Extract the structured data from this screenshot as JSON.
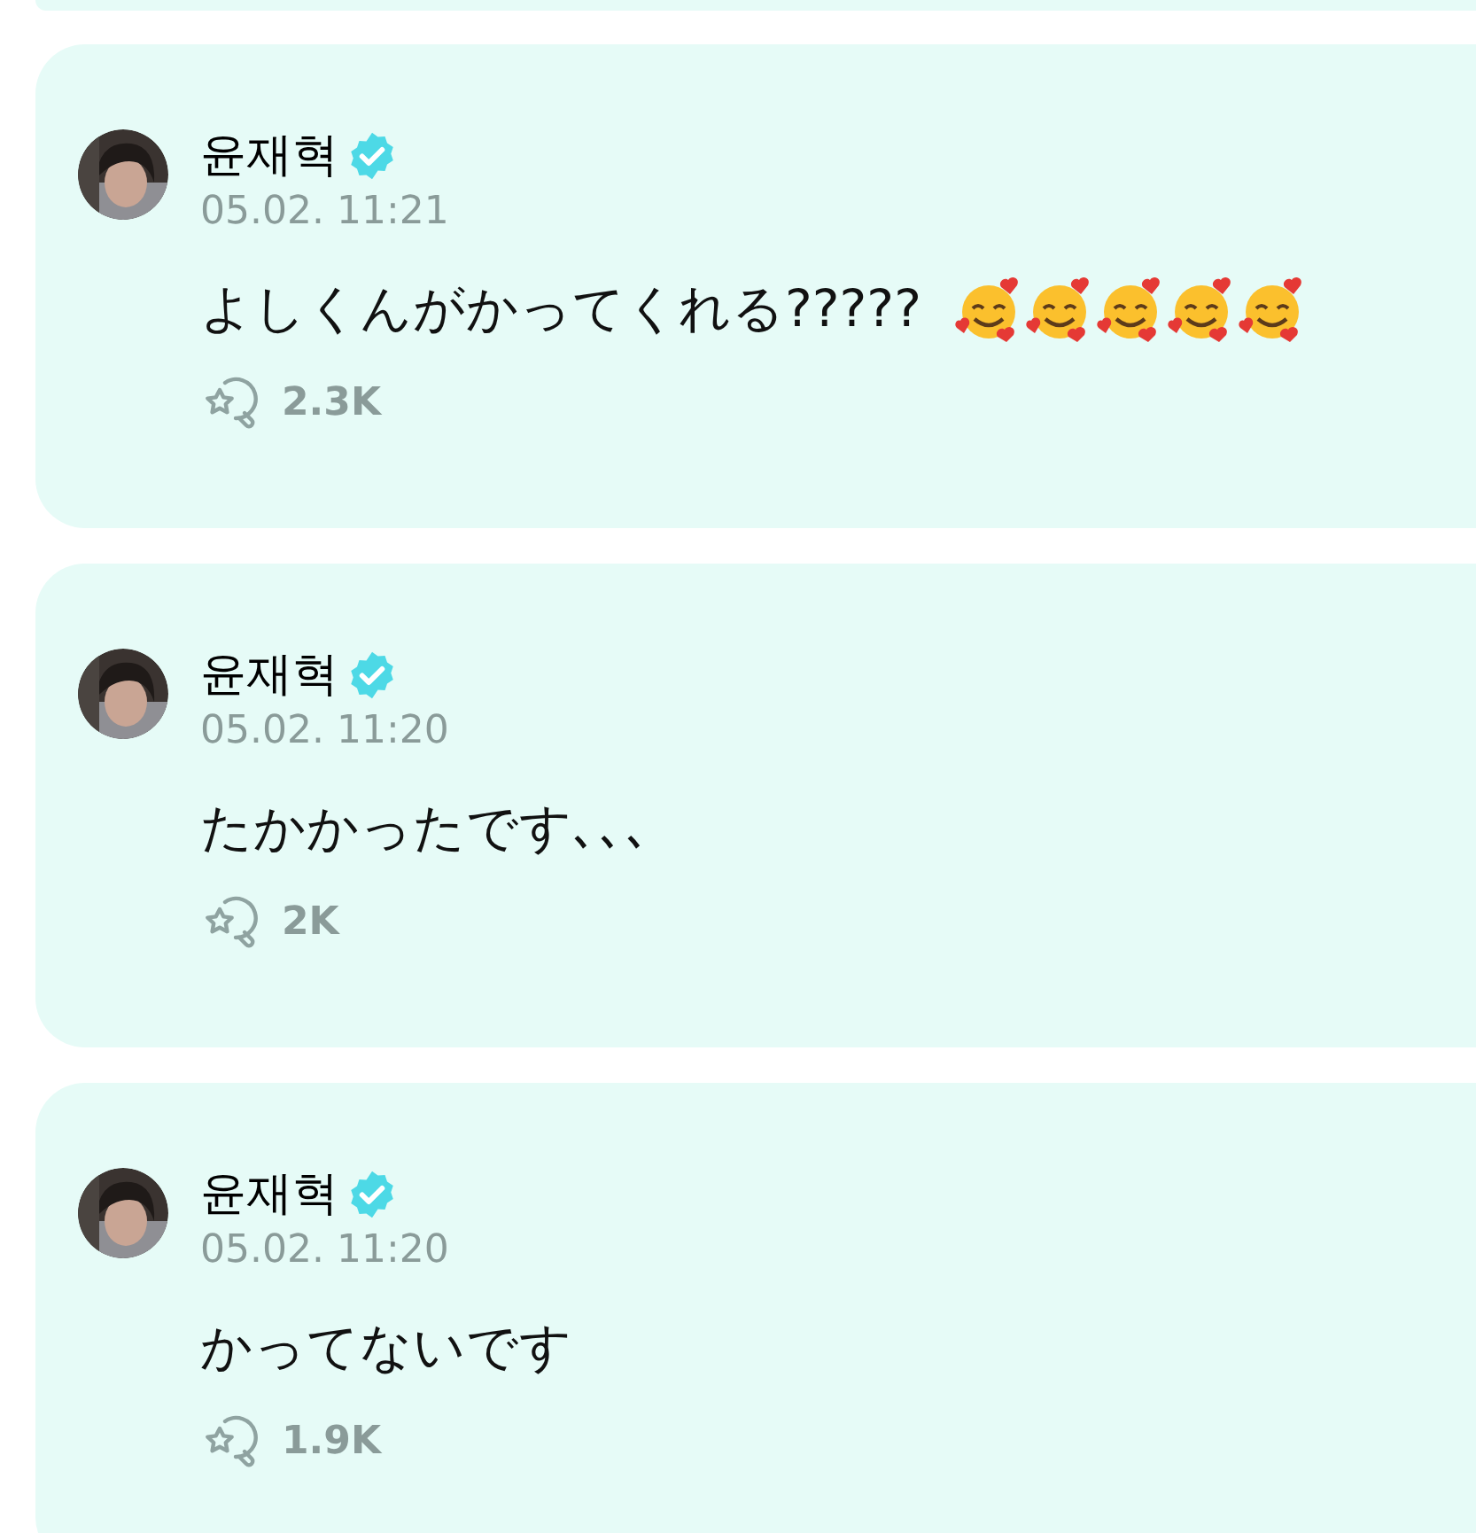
{
  "posts": [
    {
      "author": "윤재혁",
      "verified": true,
      "time": "05.02. 11:21",
      "text": "よしくんがかってくれる?????",
      "emojis": [
        {
          "kind": "hearts-smile"
        },
        {
          "kind": "hearts-smile"
        },
        {
          "kind": "hearts-smile"
        },
        {
          "kind": "hearts-smile"
        },
        {
          "kind": "hearts-smile"
        }
      ],
      "reactions": "2.3K"
    },
    {
      "author": "윤재혁",
      "verified": true,
      "time": "05.02. 11:20",
      "text": "たかかったです､､､",
      "reactions": "2K"
    },
    {
      "author": "윤재혁",
      "verified": true,
      "time": "05.02. 11:20",
      "text": "かってないです",
      "reactions": "1.9K"
    }
  ]
}
